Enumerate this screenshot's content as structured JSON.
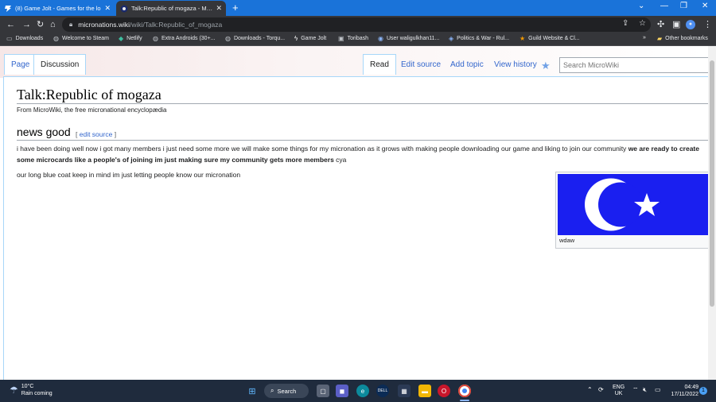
{
  "browser": {
    "tabs": [
      {
        "title": "(8) Game Jolt - Games for the lo",
        "favicon": "game-jolt-icon"
      },
      {
        "title": "Talk:Republic of mogaza - Micro",
        "favicon": "microwiki-icon"
      }
    ],
    "address": {
      "host": "micronations.wiki",
      "path": "/wiki/Talk:Republic_of_mogaza"
    },
    "bookmarks": [
      {
        "label": "Downloads",
        "icon": "folder-icon"
      },
      {
        "label": "Welcome to Steam",
        "icon": "steam-icon"
      },
      {
        "label": "Netlify",
        "icon": "netlify-icon"
      },
      {
        "label": "Extra Androids (30+...",
        "icon": "steam-icon"
      },
      {
        "label": "Downloads - Torqu...",
        "icon": "steam-icon"
      },
      {
        "label": "Game Jolt",
        "icon": "game-jolt-icon"
      },
      {
        "label": "Toribash",
        "icon": "toribash-icon"
      },
      {
        "label": "User waligulkhan11...",
        "icon": "user-icon"
      },
      {
        "label": "Politics & War - Rul...",
        "icon": "globe-icon"
      },
      {
        "label": "Guild Website & Cl...",
        "icon": "star-icon"
      }
    ],
    "bookmarks_more": "»",
    "other_bookmarks": "Other bookmarks"
  },
  "wiki": {
    "tabs_left": {
      "page": "Page",
      "discussion": "Discussion"
    },
    "tabs_right": {
      "read": "Read",
      "edit_source": "Edit source",
      "add_topic": "Add topic",
      "view_history": "View history"
    },
    "search_placeholder": "Search MicroWiki",
    "title": "Talk:Republic of mogaza",
    "tagline": "From MicroWiki, the free micronational encyclopædia",
    "section": {
      "heading": "news good",
      "edit_open": "[ ",
      "edit_link": "edit source",
      "edit_close": " ]"
    },
    "para1_normal": "i have been doing well now i got many members i just need some more we will make some things for my micronation as it grows with making people downloading our game and liking to join our community ",
    "para1_bold": "we are ready to create some microcards like a people's of joining im just making sure my community gets more members",
    "para1_tail": " cya",
    "para2": "our long blue coat keep in mind im just letting people know our micronation",
    "thumb_caption": "wdaw"
  },
  "taskbar": {
    "weather_temp": "10°C",
    "weather_text": "Rain coming",
    "search_label": "Search",
    "lang_top": "ENG",
    "lang_bottom": "UK",
    "time": "04:49",
    "date": "17/11/2022",
    "notifications": "1"
  }
}
